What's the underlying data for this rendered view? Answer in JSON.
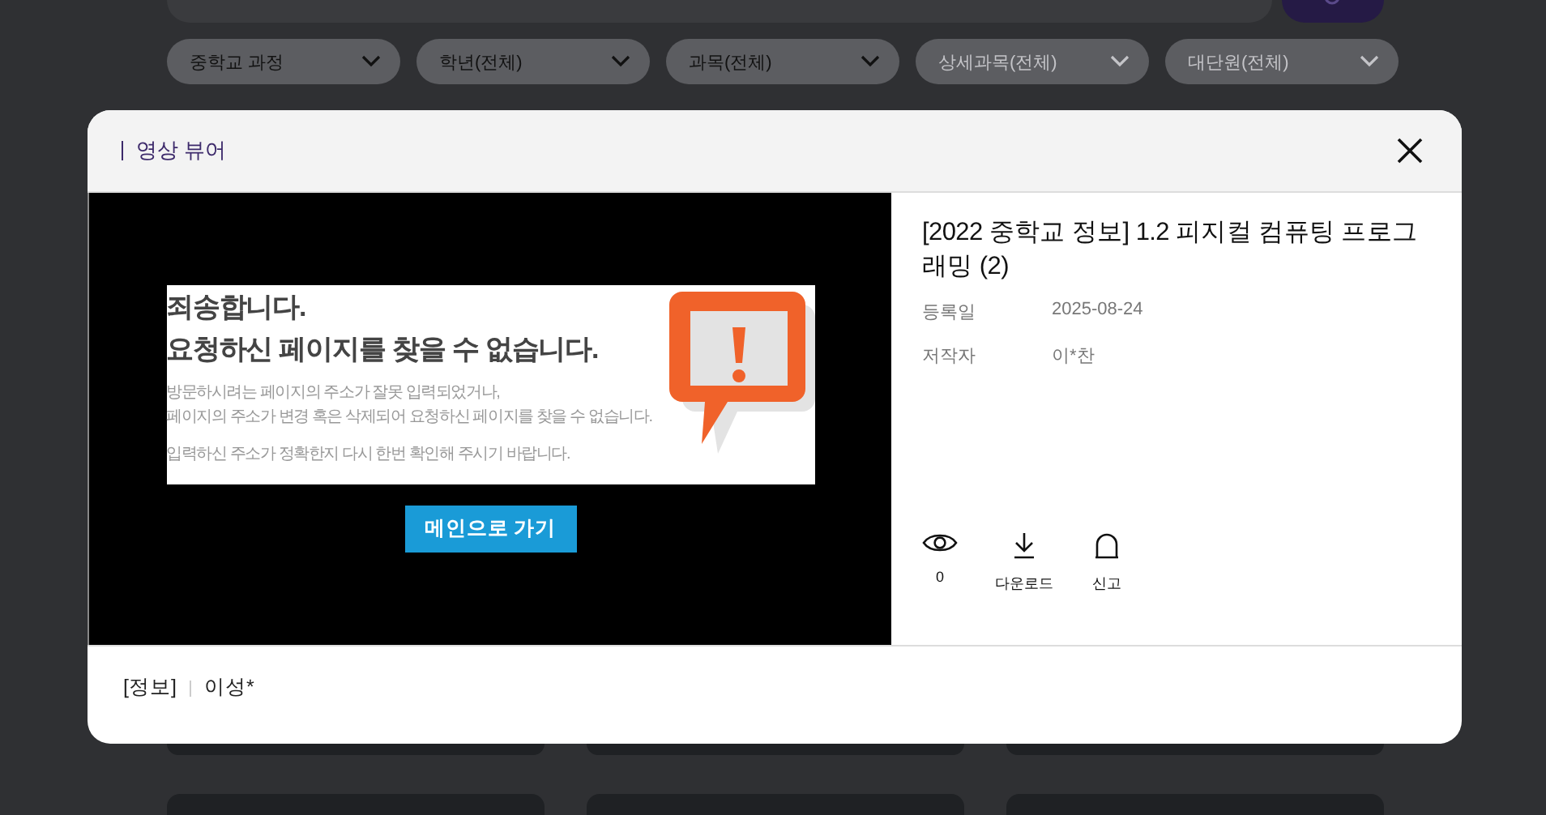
{
  "filters": [
    {
      "label": "중학교 과정",
      "disabled": false
    },
    {
      "label": "학년(전체)",
      "disabled": false
    },
    {
      "label": "과목(전체)",
      "disabled": false
    },
    {
      "label": "상세과목(전체)",
      "disabled": true
    },
    {
      "label": "대단원(전체)",
      "disabled": true
    }
  ],
  "modal": {
    "title": "영상 뷰어",
    "video": {
      "error_page": {
        "heading_lines": [
          "죄송합니다.",
          "요청하신 페이지를 찾을 수 없습니다."
        ],
        "paragraphs": [
          [
            "방문하시려는 페이지의 주소가 잘못 입력되었거나,",
            "페이지의 주소가 변경 혹은 삭제되어 요청하신 페이지를 찾을 수 없습니다."
          ],
          [
            "입력하신 주소가 정확한지 다시 한번 확인해 주시기 바랍니다."
          ]
        ],
        "button": "메인으로 가기"
      }
    },
    "info": {
      "title": "[2022 중학교 정보] 1.2 피지컬 컴퓨팅 프로그래밍 (2)",
      "meta": [
        {
          "label": "등록일",
          "value": "2025-08-24"
        },
        {
          "label": "저작자",
          "value": "이*찬"
        }
      ],
      "actions": [
        {
          "kind": "views",
          "label": "0"
        },
        {
          "kind": "download",
          "label": "다운로드"
        },
        {
          "kind": "report",
          "label": "신고"
        }
      ]
    },
    "footer": {
      "category": "[정보]",
      "author": "이성*"
    }
  }
}
